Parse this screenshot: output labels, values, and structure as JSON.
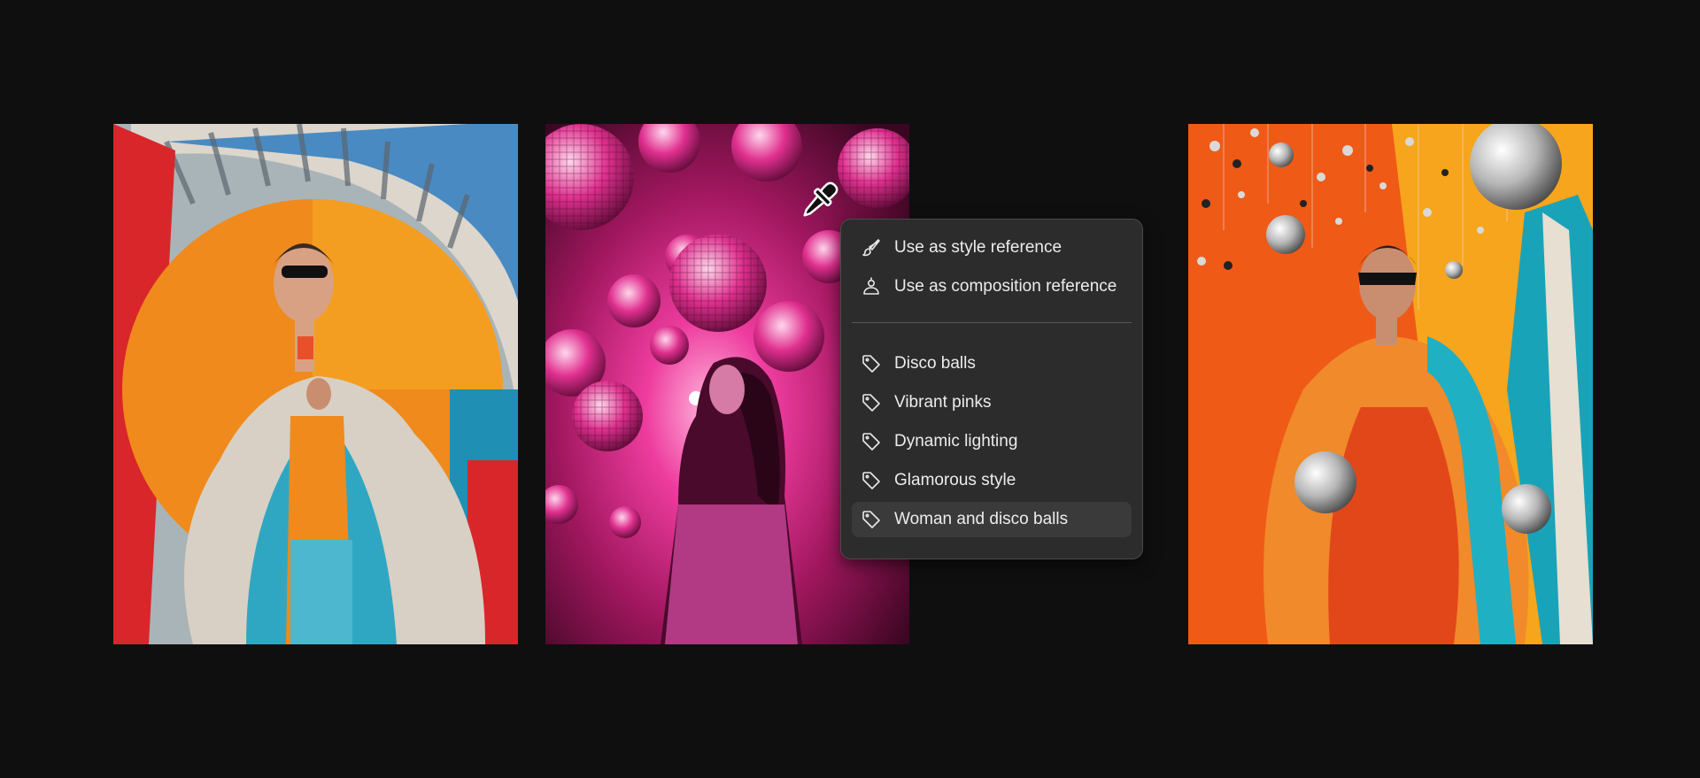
{
  "menu": {
    "actions": [
      {
        "label": "Use as style reference",
        "icon": "paintbrush-icon"
      },
      {
        "label": "Use as composition reference",
        "icon": "composition-person-icon"
      }
    ],
    "tags": [
      {
        "label": "Disco balls",
        "icon": "tag-icon"
      },
      {
        "label": "Vibrant pinks",
        "icon": "tag-icon"
      },
      {
        "label": "Dynamic lighting",
        "icon": "tag-icon"
      },
      {
        "label": "Glamorous style",
        "icon": "tag-icon"
      },
      {
        "label": "Woman and disco balls",
        "icon": "tag-icon"
      }
    ],
    "hovered_item": "Woman and disco balls"
  },
  "images": [
    {
      "name": "fashion-photo-orange-coat",
      "palette": [
        "#f08a1c",
        "#e8502a",
        "#2fa7c3",
        "#d8d0c4"
      ]
    },
    {
      "name": "disco-ball-pink-room",
      "palette": [
        "#e0308f",
        "#7a0f4e",
        "#ffd6ec"
      ]
    },
    {
      "name": "fashion-photo-disco-balls",
      "palette": [
        "#ef5a17",
        "#f7a51c",
        "#19a3b8",
        "#c8c8c8"
      ]
    }
  ],
  "colors": {
    "background": "#0f0f10",
    "menu_bg": "#2c2c2c",
    "menu_text": "#ececec"
  }
}
